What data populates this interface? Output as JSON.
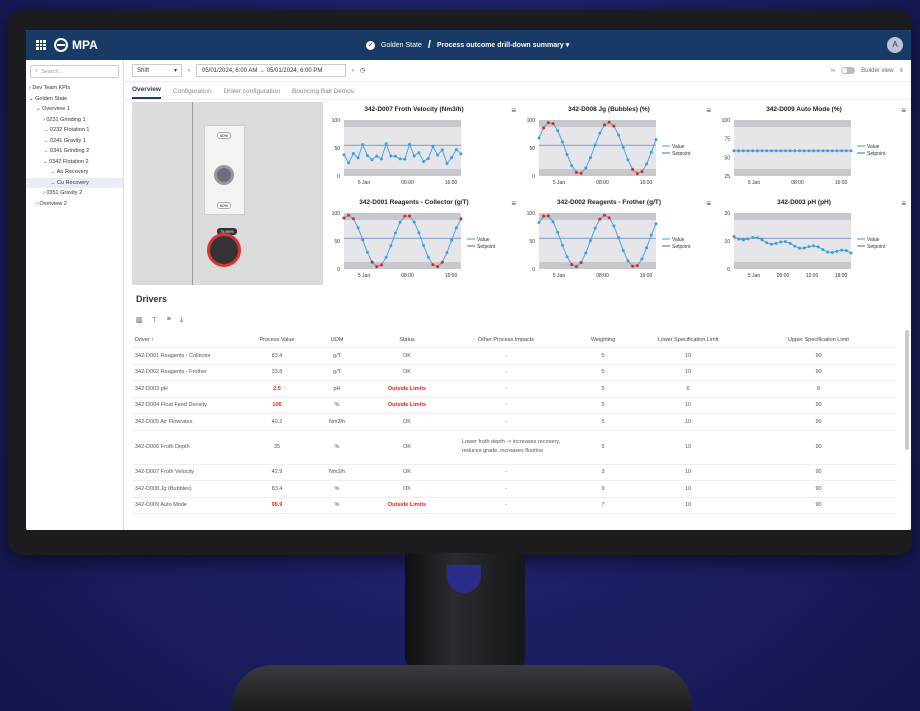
{
  "app": {
    "logo_text": "MPA",
    "avatar_initial": "A"
  },
  "breadcrumb": {
    "site": "Golden State",
    "separator": "/",
    "page": "Process outcome drill-down summary ▾"
  },
  "sidebar": {
    "search_placeholder": "Search...",
    "items": [
      {
        "label": "› Dev Team KPIs",
        "indent": 0
      },
      {
        "label": "⌄ Golden State",
        "indent": 0
      },
      {
        "label": "⌄ Overview 1",
        "indent": 1
      },
      {
        "label": "› 0231 Grinding 1",
        "indent": 2
      },
      {
        "label": "→ 0232 Flotation 1",
        "indent": 2
      },
      {
        "label": "→ 0241 Gravity 1",
        "indent": 2
      },
      {
        "label": "→ 0341 Grinding 2",
        "indent": 2
      },
      {
        "label": "⌄ 0342 Flotation 2",
        "indent": 2
      },
      {
        "label": "→ Au Recovery",
        "indent": 3
      },
      {
        "label": "→ Cu Recovery",
        "indent": 3,
        "selected": true
      },
      {
        "label": "› 0351 Gravity 2",
        "indent": 2
      },
      {
        "label": "› Overview 2",
        "indent": 1
      }
    ]
  },
  "toolbar": {
    "shift_label": "Shift",
    "date_range": "05/01/2024, 6:00 AM  →  05/01/2024, 6:00 PM",
    "builder_view": "Builder view"
  },
  "tabs": [
    "Overview",
    "Configuration",
    "Driver configuration",
    "Bouncing Ball Demos"
  ],
  "visual": {
    "pill_top": "60%",
    "pill_bottom": "60%",
    "pill_red": "75.90%"
  },
  "charts": [
    {
      "title": "342-D007 Froth Velocity (Nm3/h)",
      "yticks": [
        "100",
        "50",
        "0"
      ],
      "xticks": [
        "5 Jan",
        "06:00",
        "16:00"
      ],
      "legend": []
    },
    {
      "title": "342-D008 Jg (Bubbles) (%)",
      "yticks": [
        "100",
        "50",
        "0"
      ],
      "xticks": [
        "5 Jan",
        "08:00",
        "16:00"
      ],
      "legend": [
        "Value",
        "Setpoint"
      ]
    },
    {
      "title": "342-D009 Auto Mode (%)",
      "yticks": [
        "100",
        "75",
        "50",
        "25"
      ],
      "xticks": [
        "5 Jan",
        "08:00",
        "16:00"
      ],
      "legend": [
        "Value",
        "Setpoint"
      ]
    },
    {
      "title": "342-D001 Reagents - Collector (g/T)",
      "yticks": [
        "100",
        "50",
        "0"
      ],
      "xticks": [
        "5 Jan",
        "08:00",
        "16:00"
      ],
      "legend": [
        "Value",
        "Setpoint"
      ]
    },
    {
      "title": "342-D002 Reagents - Frother (g/T)",
      "yticks": [
        "100",
        "50",
        "0"
      ],
      "xticks": [
        "5 Jan",
        "08:00",
        "16:00"
      ],
      "legend": [
        "Value",
        "Setpoint"
      ]
    },
    {
      "title": "342-D003 pH (pH)",
      "yticks": [
        "20",
        "10",
        "0"
      ],
      "xticks": [
        "5 Jan",
        "06:00",
        "12:00",
        "18:00"
      ],
      "legend": [
        "Value",
        "Setpoint"
      ]
    }
  ],
  "drivers": {
    "title": "Drivers",
    "columns": [
      "Driver ↑",
      "Process Value",
      "UOM",
      "Status",
      "Other Process Impacts",
      "Weighting",
      "Lower Specification Limit",
      "Upper Specification Limit"
    ],
    "rows": [
      [
        "342-D001 Reagents - Collector",
        "83.4",
        "g/T",
        "OK",
        "-",
        "5",
        "10",
        "90"
      ],
      [
        "342-D002 Reagents - Frother",
        "33.8",
        "g/T",
        "OK",
        "-",
        "5",
        "10",
        "90"
      ],
      [
        "342-D003 pH",
        "2.5",
        "pH",
        "Outside Limits",
        "-",
        "5",
        "6",
        "8"
      ],
      [
        "342-D004 Float Feed Density",
        "106",
        "%",
        "Outside Limits",
        "-",
        "5",
        "10",
        "90"
      ],
      [
        "342-D005 Air Flowrates",
        "40.2",
        "Nm3/h",
        "OK",
        "-",
        "5",
        "10",
        "90"
      ],
      [
        "342-D006 Froth Depth",
        "35",
        "%",
        "OK",
        "Lower froth depth -> increases recovery, reduces grade, increases fluorine",
        "5",
        "10",
        "90"
      ],
      [
        "342-D007 Froth Velocity",
        "42.9",
        "Nm3/h",
        "OK",
        "-",
        "3",
        "10",
        "90"
      ],
      [
        "342-D008 Jg (Bubbles)",
        "83.4",
        "%",
        "OK",
        "-",
        "9",
        "10",
        "90"
      ],
      [
        "342-D009 Auto Mode",
        "95.9",
        "%",
        "Outside Limits",
        "-",
        "7",
        "10",
        "90"
      ]
    ]
  },
  "colors": {
    "header": "#1a3a66",
    "value_line": "#3aa0e0",
    "out_of_spec": "#e0261a"
  }
}
